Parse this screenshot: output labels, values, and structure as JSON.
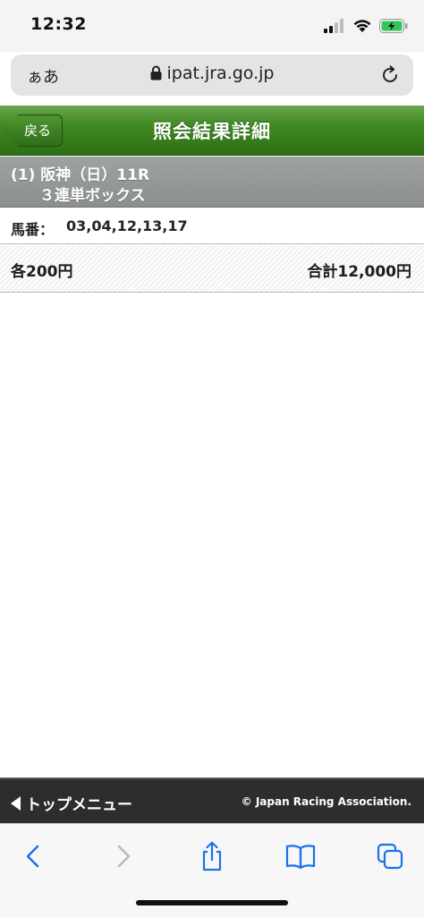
{
  "status_bar": {
    "time": "12:32",
    "icons": [
      "signal-icon",
      "wifi-icon",
      "battery-charging-icon"
    ]
  },
  "browser": {
    "aa_label": "ぁあ",
    "url": "ipat.jra.go.jp",
    "icons": [
      "lock-icon",
      "reload-icon"
    ]
  },
  "header": {
    "back_label": "戻る",
    "title": "照会結果詳細"
  },
  "race": {
    "line1": "(1) 阪神（日）11R",
    "line2": "３連単ボックス"
  },
  "horses": {
    "label": "馬番：",
    "value": "03,04,12,13,17"
  },
  "amount": {
    "each": "各200円",
    "total": "合計12,000円"
  },
  "footer": {
    "top_menu_label": "トップメニュー",
    "copyright": "© Japan Racing Association."
  },
  "toolbar": {
    "icons": [
      "back-icon",
      "forward-icon",
      "share-icon",
      "bookmarks-icon",
      "tabs-icon"
    ]
  },
  "colors": {
    "header_green": "#3f8a22",
    "race_gray": "#9ea39f",
    "footer_dark": "#2d2d2d",
    "ios_blue": "#1a73e8"
  }
}
